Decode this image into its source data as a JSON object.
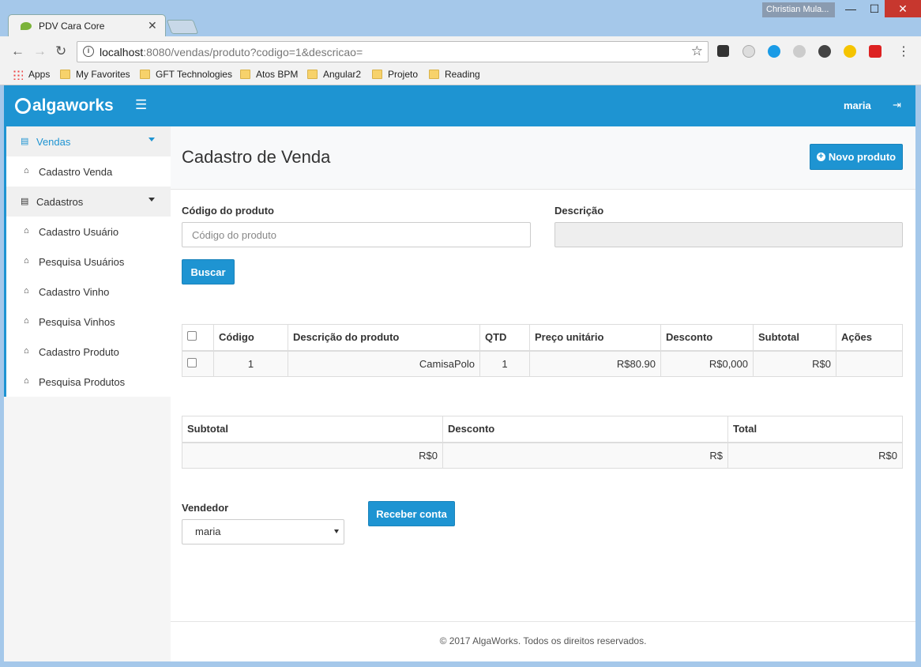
{
  "browser": {
    "profile_name": "Christian Mula...",
    "tab_title": "PDV Cara Core",
    "url_host": "localhost",
    "url_path": ":8080/vendas/produto?codigo=1&descricao=",
    "bookmarks": [
      "Apps",
      "My Favorites",
      "GFT Technologies",
      "Atos BPM",
      "Angular2",
      "Projeto",
      "Reading"
    ],
    "window_controls": {
      "minimize": "—",
      "maximize": "☐",
      "close": "✕"
    }
  },
  "header": {
    "logo": "algaworks",
    "user": "maria"
  },
  "sidebar": {
    "groups": [
      {
        "label": "Vendas",
        "items": [
          {
            "label": "Cadastro Venda"
          }
        ]
      },
      {
        "label": "Cadastros",
        "items": [
          {
            "label": "Cadastro Usuário"
          },
          {
            "label": "Pesquisa Usuários"
          },
          {
            "label": "Cadastro Vinho"
          },
          {
            "label": "Pesquisa Vinhos"
          },
          {
            "label": "Cadastro Produto"
          },
          {
            "label": "Pesquisa Produtos"
          }
        ]
      }
    ]
  },
  "page": {
    "title": "Cadastro de Venda",
    "new_product_button": "Novo produto"
  },
  "search_form": {
    "code_label": "Código do produto",
    "code_placeholder": "Código do produto",
    "code_value": "",
    "description_label": "Descrição",
    "description_value": "",
    "search_button": "Buscar"
  },
  "items_table": {
    "headers": [
      "Código",
      "Descrição do produto",
      "QTD",
      "Preço unitário",
      "Desconto",
      "Subtotal",
      "Ações"
    ],
    "rows": [
      {
        "codigo": "1",
        "descricao": "CamisaPolo",
        "qtd": "1",
        "preco": "R$80.90",
        "desconto": "R$0,000",
        "subtotal": "R$0",
        "acoes": ""
      }
    ]
  },
  "totals_table": {
    "headers": [
      "Subtotal",
      "Desconto",
      "Total"
    ],
    "values": [
      "R$0",
      "R$",
      "R$0"
    ]
  },
  "seller": {
    "label": "Vendedor",
    "selected": "maria"
  },
  "receive_button": "Receber conta",
  "footer": "© 2017 AlgaWorks. Todos os direitos reservados.",
  "colors": {
    "primary": "#1e94d2",
    "sidebar_bg": "#f5f5f5"
  }
}
